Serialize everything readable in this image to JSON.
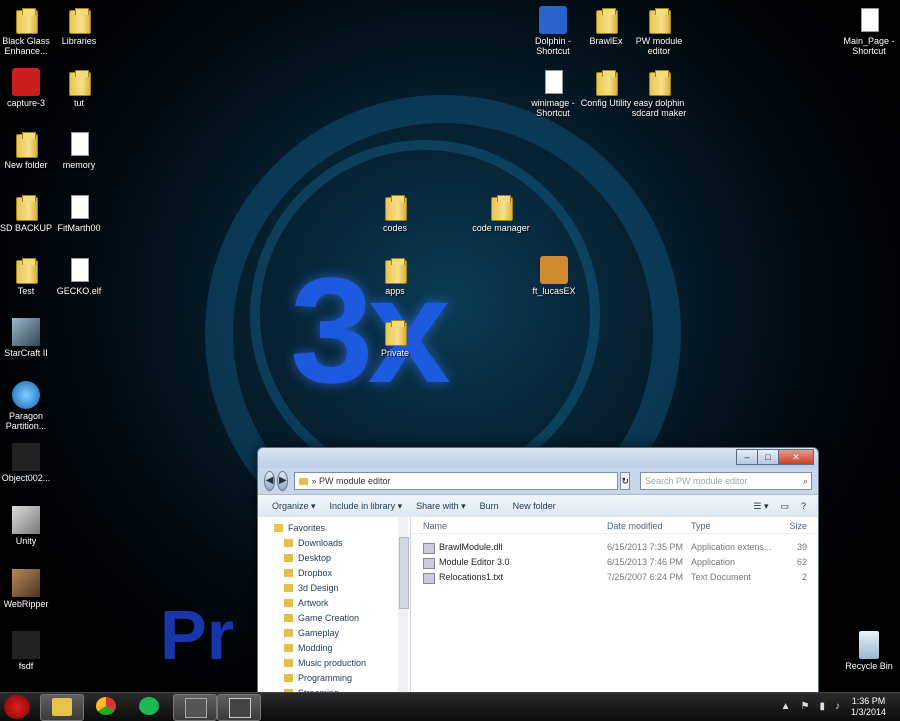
{
  "desktop_icons": [
    {
      "label": "Black Glass Enhance...",
      "type": "folder"
    },
    {
      "label": "Libraries",
      "type": "folder"
    },
    {
      "label": "capture-3",
      "type": "red"
    },
    {
      "label": "tut",
      "type": "folder"
    },
    {
      "label": "New folder",
      "type": "folder"
    },
    {
      "label": "memory",
      "type": "file"
    },
    {
      "label": "SD BACKUP",
      "type": "folder"
    },
    {
      "label": "FitMarth00",
      "type": "file"
    },
    {
      "label": "Test",
      "type": "folder"
    },
    {
      "label": "GECKO.elf",
      "type": "file"
    },
    {
      "label": "StarCraft II",
      "type": "sc"
    },
    {
      "label": "Paragon Partition...",
      "type": "blue"
    },
    {
      "label": "Object002...",
      "type": "dark"
    },
    {
      "label": "Unity",
      "type": "unity"
    },
    {
      "label": "WebRipper",
      "type": "img"
    },
    {
      "label": "fsdf",
      "type": "dark"
    },
    {
      "label": "codes",
      "type": "folder"
    },
    {
      "label": "code manager",
      "type": "folder"
    },
    {
      "label": "apps",
      "type": "folder"
    },
    {
      "label": "ft_lucasEX",
      "type": "orange"
    },
    {
      "label": "Private",
      "type": "folder"
    },
    {
      "label": "Dolphin - Shortcut",
      "type": "dolphin"
    },
    {
      "label": "BrawlEx",
      "type": "folder"
    },
    {
      "label": "PW module editor",
      "type": "folder"
    },
    {
      "label": "winimage - Shortcut",
      "type": "file"
    },
    {
      "label": "Config Utility",
      "type": "folder"
    },
    {
      "label": "easy dolphin sdcard maker",
      "type": "folder"
    },
    {
      "label": "Main_Page - Shortcut",
      "type": "file"
    },
    {
      "label": "Recycle Bin",
      "type": "bin"
    }
  ],
  "explorer": {
    "address": "PW module editor",
    "search_placeholder": "Search PW module editor",
    "toolbar": {
      "organize": "Organize ▾",
      "include_in_library": "Include in library ▾",
      "share_with": "Share with ▾",
      "burn": "Burn",
      "new_folder": "New folder"
    },
    "nav": [
      "Favorites",
      "Downloads",
      "Desktop",
      "Dropbox",
      "3d Design",
      "Artwork",
      "Game Creation",
      "Gameplay",
      "Modding",
      "Music production",
      "Programming",
      "Streaming"
    ],
    "columns": {
      "name": "Name",
      "date": "Date modified",
      "type": "Type",
      "size": "Size"
    },
    "files": [
      {
        "name": "BrawlModule.dll",
        "date": "6/15/2013 7:35 PM",
        "type": "Application extens...",
        "size": "39"
      },
      {
        "name": "Module Editor 3.0",
        "date": "6/15/2013 7:46 PM",
        "type": "Application",
        "size": "62"
      },
      {
        "name": "Relocations1.txt",
        "date": "7/25/2007 6:24 PM",
        "type": "Text Document",
        "size": "2"
      }
    ]
  },
  "clock": {
    "time": "1:36 PM",
    "date": "1/3/2014"
  },
  "wallpaper_text": {
    "logo": "3x",
    "partial": "Pr"
  }
}
